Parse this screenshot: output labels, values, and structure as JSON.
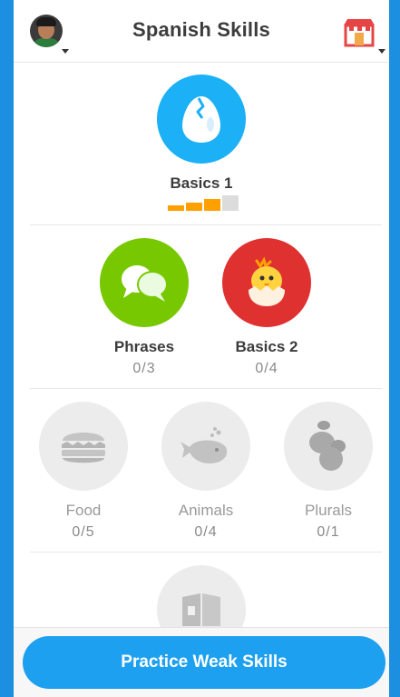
{
  "header": {
    "title": "Spanish Skills",
    "avatar_icon": "user-avatar",
    "shop_icon": "store-icon"
  },
  "skills": {
    "basics1": {
      "name": "Basics 1",
      "icon": "cracked-egg-icon",
      "strength_bars": 3,
      "strength_max": 4,
      "color": "#1cb0f6"
    },
    "phrases": {
      "name": "Phrases",
      "progress": "0/3",
      "icon": "speech-bubbles-icon",
      "color": "#78c800"
    },
    "basics2": {
      "name": "Basics 2",
      "progress": "0/4",
      "icon": "hatching-chick-icon",
      "color": "#e03131"
    },
    "food": {
      "name": "Food",
      "progress": "0/5",
      "icon": "burger-icon",
      "locked": true
    },
    "animals": {
      "name": "Animals",
      "progress": "0/4",
      "icon": "whale-icon",
      "locked": true
    },
    "plurals": {
      "name": "Plurals",
      "progress": "0/1",
      "icon": "plural-blobs-icon",
      "locked": true
    },
    "next": {
      "icon": "book-icon",
      "locked": true
    }
  },
  "footer": {
    "practice_label": "Practice Weak Skills"
  },
  "colors": {
    "accent": "#1ca0ef",
    "background": "#1c8fe0",
    "locked": "#e5e5e5",
    "strength": "#ffa000"
  }
}
